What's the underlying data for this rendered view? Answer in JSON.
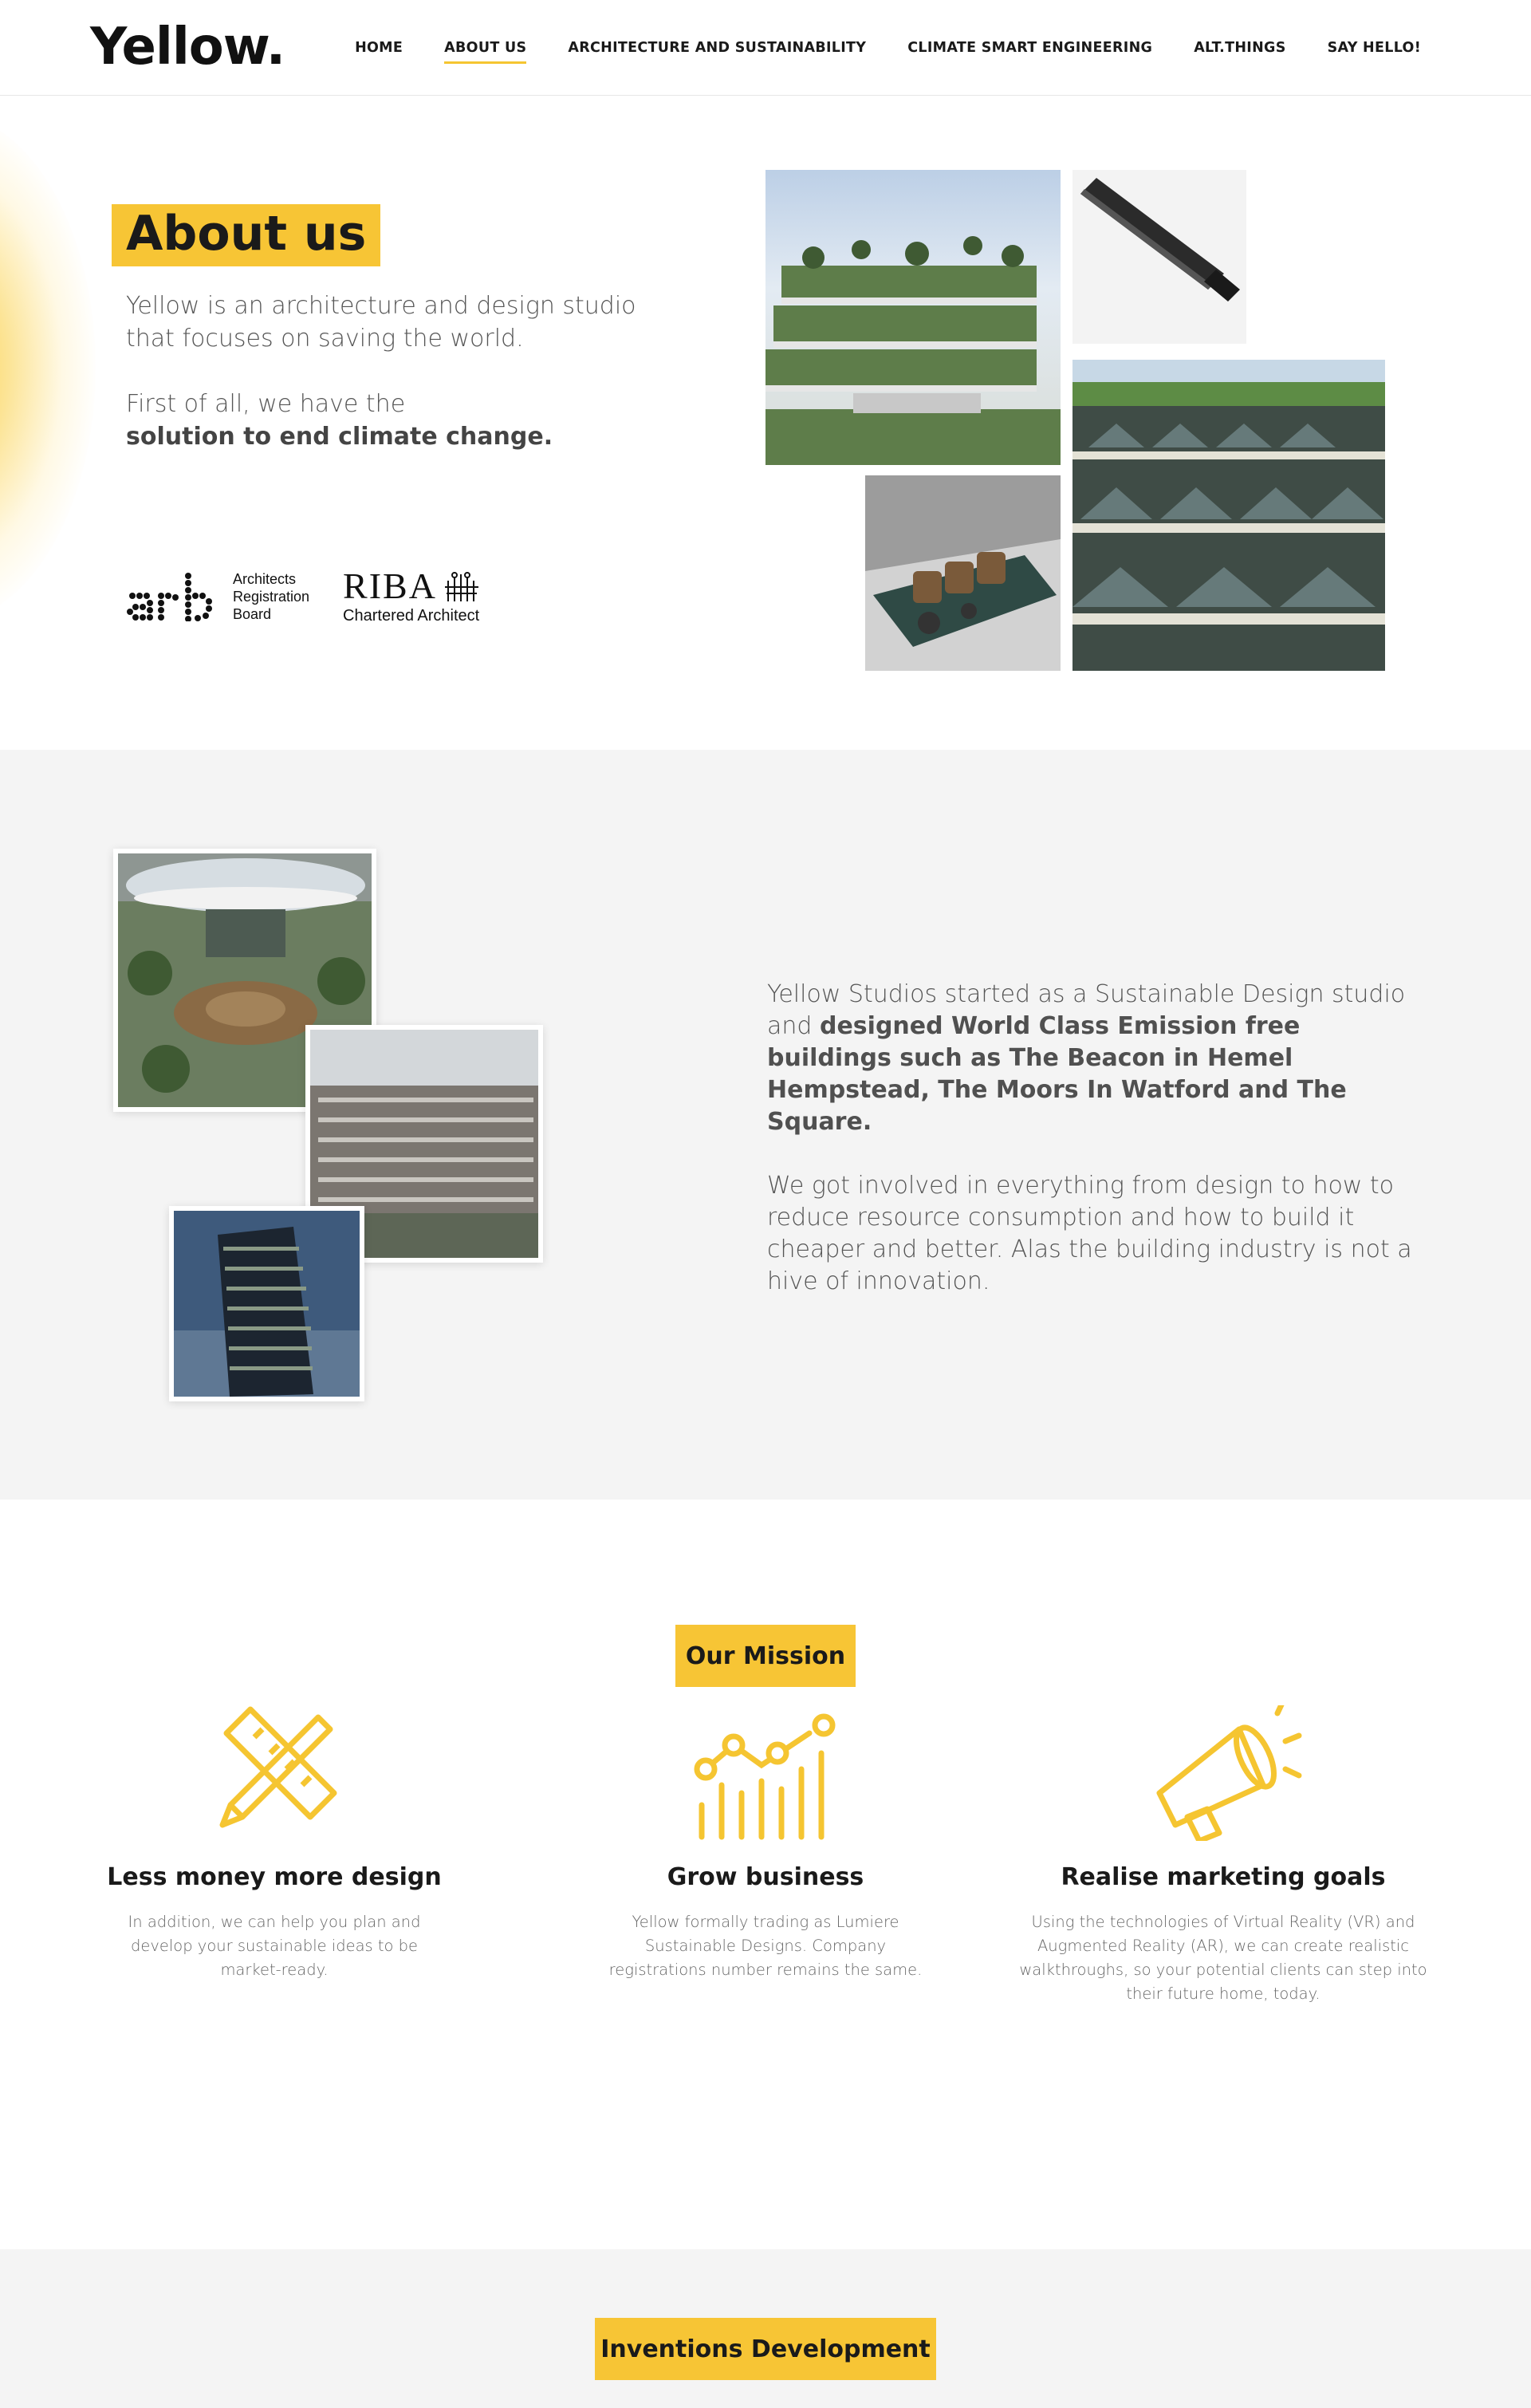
{
  "header": {
    "logo": "Yellow.",
    "nav": [
      {
        "label": "HOME",
        "active": false
      },
      {
        "label": "ABOUT US",
        "active": true
      },
      {
        "label": "ARCHITECTURE AND SUSTAINABILITY",
        "active": false
      },
      {
        "label": "CLIMATE SMART ENGINEERING",
        "active": false
      },
      {
        "label": "ALT.THINGS",
        "active": false
      },
      {
        "label": "SAY HELLO!",
        "active": false
      }
    ]
  },
  "about": {
    "title": "About us",
    "intro": "Yellow is an architecture and design studio that focuses on saving the world.",
    "lead": "First of all, we have the",
    "lead_bold": "solution to end climate change.",
    "arb": {
      "line1": "Architects",
      "line2": "Registration",
      "line3": "Board",
      "mark": "arb"
    },
    "riba": {
      "word": "RIBA",
      "sub": "Chartered Architect"
    }
  },
  "story": {
    "p1_start": "Yellow Studios started as a Sustainable Design studio and ",
    "p1_bold": "designed World Class Emission free buildings such as The Beacon in Hemel Hempstead, The Moors In Watford and The Square.",
    "p2": "We got involved in everything from design to how to reduce resource consumption and how to build it cheaper and better. Alas the building industry is not a hive of innovation."
  },
  "mission": {
    "title": "Our Mission",
    "columns": [
      {
        "icon": "pencil-ruler-icon",
        "heading": "Less money more design",
        "body": "In addition, we can help you plan and develop your sustainable ideas to be market-ready."
      },
      {
        "icon": "growth-chart-icon",
        "heading": "Grow business",
        "body": "Yellow formally trading as Lumiere Sustainable Designs. Company registrations number remains the same."
      },
      {
        "icon": "megaphone-icon",
        "heading": "Realise marketing goals",
        "body": "Using the technologies of Virtual Reality (VR) and Augmented Reality (AR), we can create realistic walkthroughs, so your potential clients can step into their future home, today."
      }
    ]
  },
  "inventions": {
    "title": "Inventions Development"
  },
  "colors": {
    "accent": "#f7c535",
    "grey_bg": "#f4f4f4",
    "text": "#555555"
  }
}
